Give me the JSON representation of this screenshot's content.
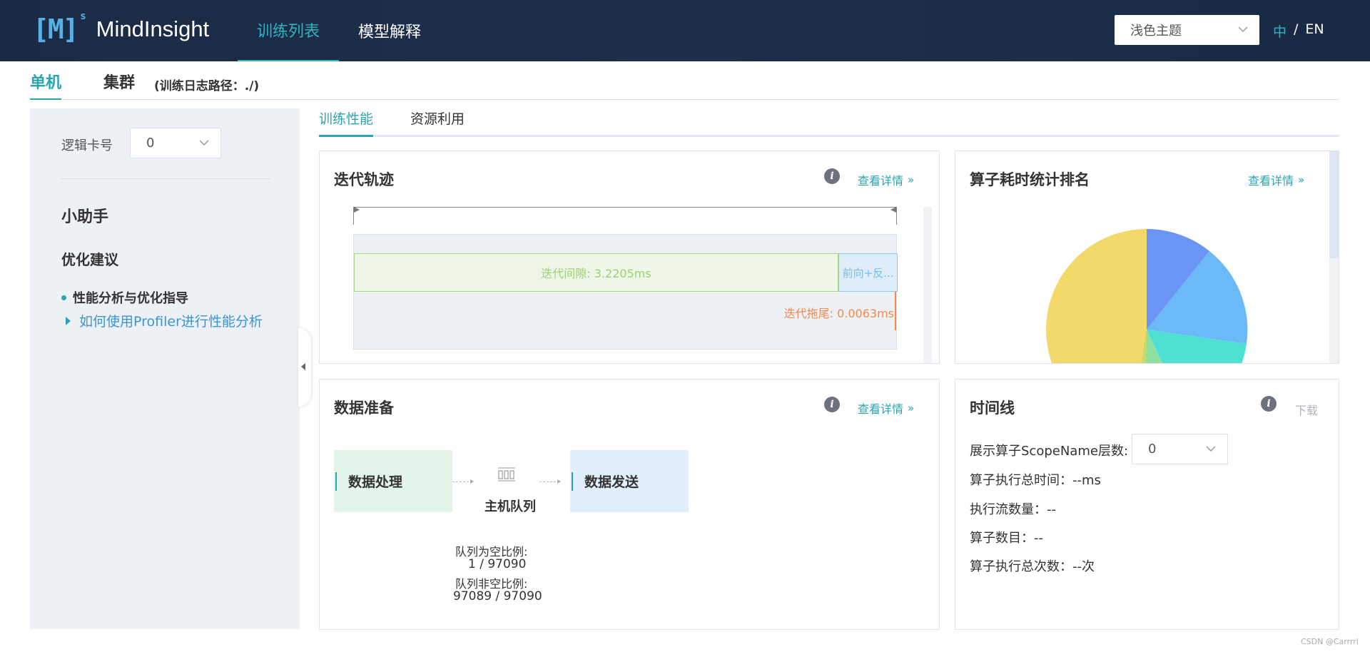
{
  "header": {
    "logo_mark": "[M]",
    "logo_sup": "s",
    "logo_text": "MindInsight",
    "nav": [
      "训练列表",
      "模型解释"
    ],
    "theme_value": "浅色主题",
    "lang_zh": "中",
    "lang_sep": "/",
    "lang_en": "EN"
  },
  "mode_tabs": {
    "single": "单机",
    "cluster": "集群",
    "log_path": "(训练日志路径：./)"
  },
  "sidebar": {
    "card_label": "逻辑卡号",
    "card_value": "0",
    "helper_title": "小助手",
    "optimize_title": "优化建议",
    "guide_title": "性能分析与优化指导",
    "guide_link": "如何使用Profiler进行性能分析"
  },
  "perf_tabs": [
    "训练性能",
    "资源利用"
  ],
  "iteration": {
    "title": "迭代轨迹",
    "detail": "查看详情",
    "gap_label": "迭代间隙: 3.2205ms",
    "fwd_label": "前向+反...",
    "tail_label": "迭代拖尾: 0.0063ms"
  },
  "operator": {
    "title": "算子耗时统计排名",
    "detail": "查看详情",
    "chart_colors": [
      "#f2d96a",
      "#6b95f5",
      "#6cb9f7",
      "#4fe0d4",
      "#8ee0a0",
      "#c2dd6e"
    ]
  },
  "data_prep": {
    "title": "数据准备",
    "detail": "查看详情",
    "process_label": "数据处理",
    "queue_label": "主机队列",
    "send_label": "数据发送",
    "empty_ratio_label": "队列为空比例:",
    "empty_ratio_value": "1 / 97090",
    "nonempty_ratio_label": "队列非空比例:",
    "nonempty_ratio_value": "97089 / 97090"
  },
  "timeline": {
    "title": "时间线",
    "download": "下载",
    "scope_label": "展示算子ScopeName层数:",
    "scope_value": "0",
    "total_time": "算子执行总时间：--ms",
    "stream_count": "执行流数量：--",
    "op_count": "算子数目：--",
    "exec_count": "算子执行总次数：--次"
  },
  "watermark": "CSDN @Carrrrl",
  "icons": {
    "info": "i",
    "detail_chevron": "»"
  }
}
